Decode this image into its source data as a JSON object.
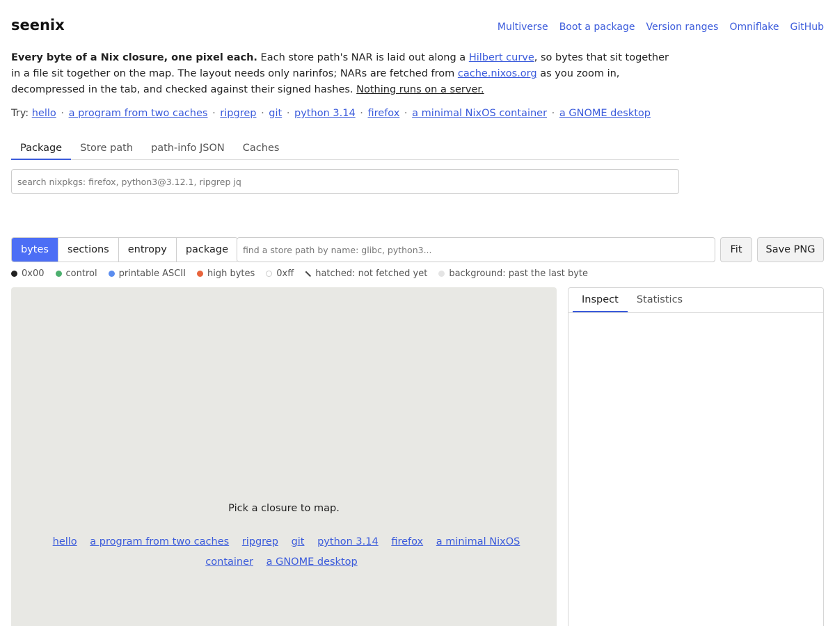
{
  "header": {
    "title": "seenix",
    "nav": [
      "Multiverse",
      "Boot a package",
      "Version ranges",
      "Omniflake",
      "GitHub"
    ]
  },
  "intro": {
    "bold": "Every byte of a Nix closure, one pixel each.",
    "part1": " Each store path's NAR is laid out along a ",
    "link1": "Hilbert curve",
    "part2": ", so bytes that sit together in a file sit together on the map. The layout needs only narinfos; NARs are fetched from ",
    "link2": "cache.nixos.org",
    "part3": " as you zoom in, decompressed in the tab, and checked against their signed hashes. ",
    "underlined": "Nothing runs on a server."
  },
  "try": {
    "label": "Try:",
    "examples": [
      "hello",
      "a program from two caches",
      "ripgrep",
      "git",
      "python 3.14",
      "firefox",
      "a minimal NixOS container",
      "a GNOME desktop"
    ],
    "separator": "·"
  },
  "tabs": [
    "Package",
    "Store path",
    "path-info JSON",
    "Caches"
  ],
  "search": {
    "placeholder": "search nixpkgs: firefox, python3@3.12.1, ripgrep jq"
  },
  "toolbar": {
    "modes": [
      "bytes",
      "sections",
      "entropy",
      "package"
    ],
    "active_mode": "bytes",
    "find_placeholder": "find a store path by name: glibc, python3...",
    "fit_label": "Fit",
    "save_label": "Save PNG"
  },
  "legend": [
    {
      "label": "0x00",
      "color": "#222222"
    },
    {
      "label": "control",
      "color": "#4caf6e"
    },
    {
      "label": "printable ASCII",
      "color": "#5b8def"
    },
    {
      "label": "high bytes",
      "color": "#e8643c"
    },
    {
      "label": "0xff",
      "color": "#ffffff"
    },
    {
      "label": "hatched: not fetched yet",
      "color": "hatch"
    },
    {
      "label": "background: past the last byte",
      "color": "#e4e4e4"
    }
  ],
  "map": {
    "message": "Pick a closure to map.",
    "examples": [
      "hello",
      "a program from two caches",
      "ripgrep",
      "git",
      "python 3.14",
      "firefox",
      "a minimal NixOS container",
      "a GNOME desktop"
    ]
  },
  "panel": {
    "tabs": [
      "Inspect",
      "Statistics"
    ]
  },
  "colors": {
    "accent": "#4c6ef5",
    "link": "#3b5bdb",
    "map_bg": "#e8e8e4"
  }
}
